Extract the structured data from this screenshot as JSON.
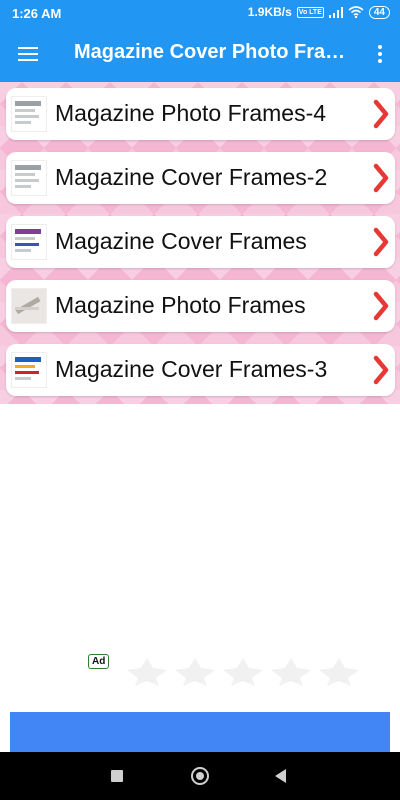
{
  "status_bar": {
    "time": "1:26 AM",
    "network_speed": "1.9KB/s",
    "volte": "Vo LTE",
    "battery": "44"
  },
  "app_bar": {
    "title": "Magazine Cover Photo Frames",
    "menu_icon": "hamburger-menu-icon",
    "overflow_icon": "more-vert-icon"
  },
  "items": [
    {
      "label": "Magazine Photo Frames-4"
    },
    {
      "label": "Magazine Cover Frames-2"
    },
    {
      "label": "Magazine Cover Frames"
    },
    {
      "label": "Magazine Photo Frames"
    },
    {
      "label": "Magazine Cover Frames-3"
    }
  ],
  "ad": {
    "badge": "Ad"
  },
  "colors": {
    "primary": "#2196f3",
    "chevron": "#e53935",
    "list_background": "#f4b6d2",
    "ad_button": "#4285f4"
  }
}
